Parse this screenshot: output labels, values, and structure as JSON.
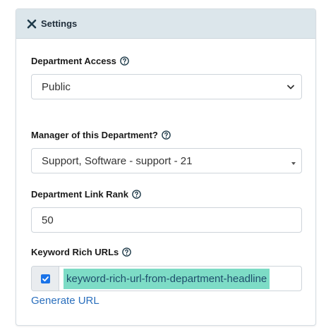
{
  "header": {
    "title": "Settings",
    "icon": "close-icon"
  },
  "fields": {
    "department_access": {
      "label": "Department Access",
      "value": "Public"
    },
    "manager": {
      "label": "Manager of this Department?",
      "value": "Support, Software - support - 21"
    },
    "link_rank": {
      "label": "Department Link Rank",
      "value": "50"
    },
    "keyword_urls": {
      "label": "Keyword Rich URLs",
      "checked": true,
      "url_value": "keyword-rich-url-from-department-headline",
      "generate_label": "Generate URL"
    }
  },
  "colors": {
    "header_bg": "#dce6eb",
    "accent": "#1a73e8",
    "highlight": "#7ddcc6",
    "link": "#2a6fbd"
  }
}
